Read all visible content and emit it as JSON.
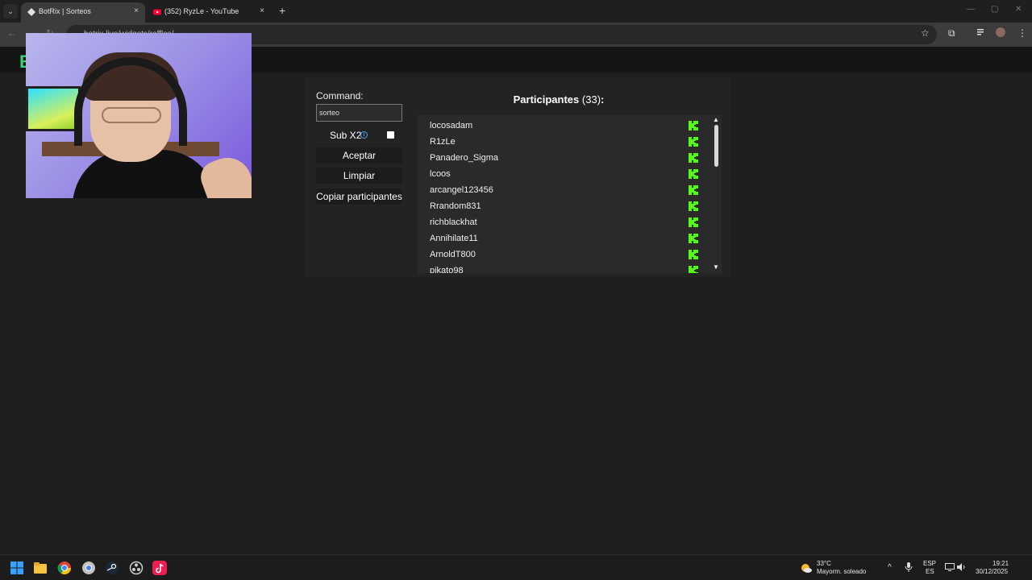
{
  "browser": {
    "tabs": [
      {
        "title": "BotRix | Sorteos",
        "active": true
      },
      {
        "title": "(352) RyzLe - YouTube",
        "active": false
      }
    ],
    "address": "botrix.live/widgets/raffles/",
    "icons": {
      "back": "←",
      "forward": "→",
      "reload": "↻",
      "star": "☆",
      "extensions": "⧉",
      "menu": "⋮",
      "newtab": "+",
      "close": "×",
      "tablist": "⌄",
      "minimize": "—",
      "maximize": "▢",
      "closewin": "✕"
    }
  },
  "app": {
    "logo": "B",
    "accent": "#36d36e"
  },
  "raffle": {
    "command_label": "Command:",
    "command_value": "sorteo",
    "sub_label": "Sub X2",
    "info_icon": "i",
    "buttons": {
      "accept": "Aceptar",
      "clear": "Limpiar",
      "copy": "Copiar participantes"
    },
    "title": "Participantes",
    "count": "(33)",
    "colon": ":",
    "participants": [
      "locosadam",
      "R1zLe",
      "Panadero_Sigma",
      "lcoos",
      "arcangel123456",
      "Rrandom831",
      "richblackhat",
      "Annihilate11",
      "ArnoldT800",
      "pikato98"
    ],
    "kick_color": "#53fc18",
    "scroll_up": "▲",
    "scroll_down": "▼"
  },
  "taskbar": {
    "weather_temp": "33°C",
    "weather_desc": "Mayorm. soleado",
    "lang_top": "ESP",
    "lang_bottom": "ES",
    "time": "19:21",
    "date": "30/12/2025",
    "chevron": "^"
  }
}
